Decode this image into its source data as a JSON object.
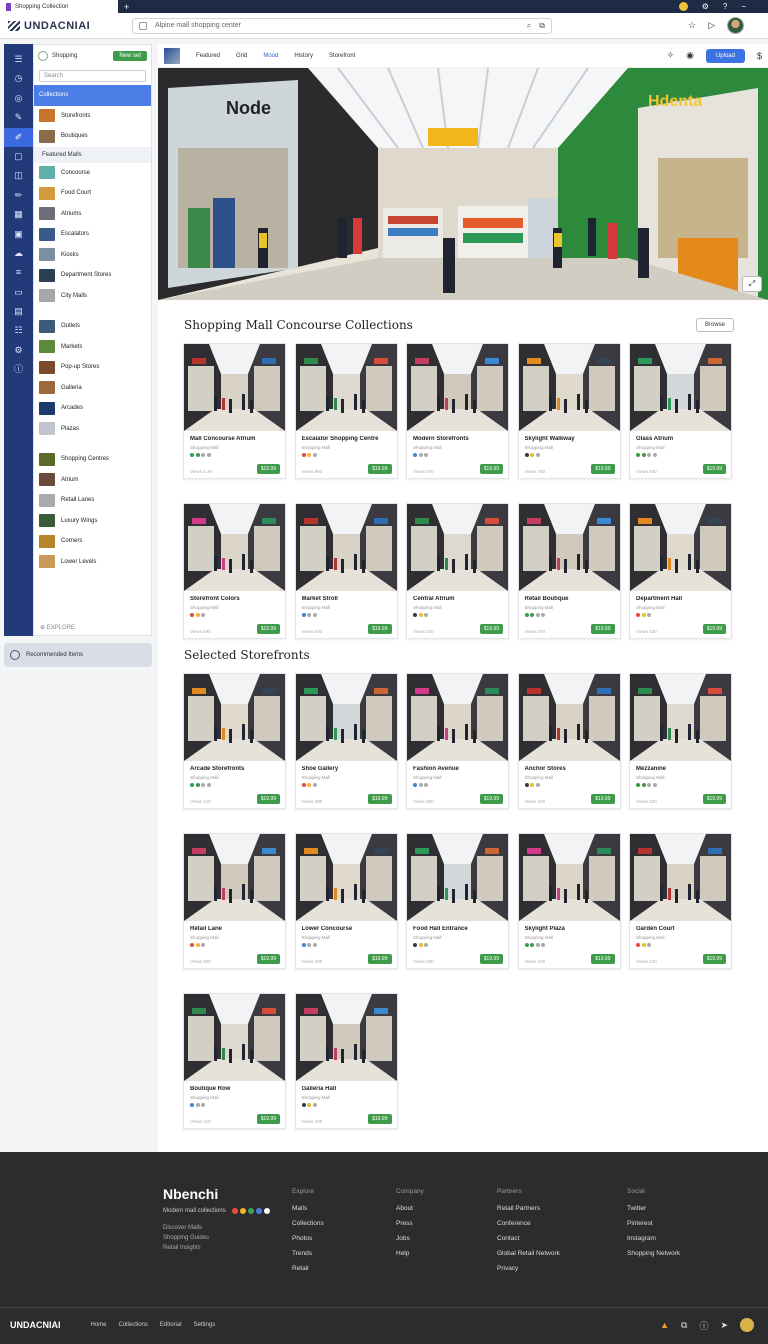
{
  "browser": {
    "tab_title": "Shopping Collection",
    "tab_plus": "+",
    "address_placeholder": "Alpine mall shopping center",
    "search_icon": "search-icon",
    "share_icon": "share-icon"
  },
  "app": {
    "logo": "UNDACNIAI"
  },
  "sidebar": {
    "title": "Shopping",
    "new_button": "New set",
    "search_placeholder": "Search",
    "items": [
      {
        "label": "Collections",
        "active": true,
        "color": "#4d7de6"
      },
      {
        "label": "Storefronts",
        "color": "#c8742a"
      },
      {
        "label": "Boutiques",
        "color": "#8a6b4a"
      },
      {
        "label": "Featured Malls",
        "group": true
      },
      {
        "label": "Concourse",
        "color": "#5fb0a8"
      },
      {
        "label": "Food Court",
        "color": "#d29a3a"
      },
      {
        "label": "Atriums",
        "color": "#6c6f7a"
      },
      {
        "label": "Escalators",
        "color": "#3a5a8a"
      },
      {
        "label": "Kiosks",
        "color": "#7d8fa2"
      },
      {
        "label": "Department Stores",
        "color": "#2d3d52"
      },
      {
        "label": "City Malls",
        "color": "#a7a7a7"
      },
      {
        "label": "",
        "gap": true
      },
      {
        "label": "Outlets",
        "color": "#3b5b7a"
      },
      {
        "label": "Markets",
        "color": "#5a8a3a"
      },
      {
        "label": "Pop-up Stores",
        "color": "#7a4a2a"
      },
      {
        "label": "Galleria",
        "color": "#9a6a3a"
      },
      {
        "label": "Arcades",
        "color": "#1c3a6a"
      },
      {
        "label": "Plazas",
        "color": "#c0c4cc"
      },
      {
        "label": "",
        "gap": true
      },
      {
        "label": "Shopping Centres",
        "color": "#5a6a2a"
      },
      {
        "label": "Atrium",
        "color": "#6a4a3a"
      },
      {
        "label": "Retail Lanes",
        "color": "#aaa"
      },
      {
        "label": "Luxury Wings",
        "color": "#3a5a3a"
      },
      {
        "label": "Corners",
        "color": "#b9852a"
      },
      {
        "label": "Lower Levels",
        "color": "#c79a5a"
      }
    ],
    "footer": "EXPLORE",
    "extra_label": "Recommended Items"
  },
  "rail_icons": [
    "menu-icon",
    "home-icon",
    "compass-icon",
    "pin-icon",
    "brush-icon",
    "square-icon",
    "layers-icon",
    "pencil-icon",
    "grid-icon",
    "image-icon",
    "cloud-icon",
    "sliders-icon",
    "card-icon",
    "table-icon",
    "list-icon",
    "settings-icon",
    "info-icon"
  ],
  "subnav": {
    "items": [
      "Featured",
      "Grid",
      "Mood",
      "History",
      "Storefront"
    ],
    "selected": 2,
    "action": "Upload"
  },
  "sections": [
    {
      "title": "Shopping Mall Concourse Collections",
      "button": "Browse"
    },
    {
      "title": "Selected Storefronts"
    }
  ],
  "cards_a": [
    {
      "title": "Mall Concourse Atrium",
      "meta": "Shopping Mall",
      "stat": "Views 1.2K",
      "price": "$19.99"
    },
    {
      "title": "Escalator Shopping Centre",
      "meta": "Shopping Mall",
      "stat": "Views 980",
      "price": "$19.99"
    },
    {
      "title": "Modern Storefronts",
      "meta": "Shopping Mall",
      "stat": "Views 870",
      "price": "$19.99"
    },
    {
      "title": "Skylight Walkway",
      "meta": "Shopping Mall",
      "stat": "Views 760",
      "price": "$19.99"
    },
    {
      "title": "Glass Atrium",
      "meta": "Shopping Mall",
      "stat": "Views 640",
      "price": "$19.99"
    },
    {
      "title": "Storefront Colors",
      "meta": "Shopping Mall",
      "stat": "Views 590",
      "price": "$19.99"
    },
    {
      "title": "Market Stroll",
      "meta": "Shopping Mall",
      "stat": "Views 540",
      "price": "$19.99"
    },
    {
      "title": "Central Atrium",
      "meta": "Shopping Mall",
      "stat": "Views 510",
      "price": "$19.99"
    },
    {
      "title": "Retail Boutique",
      "meta": "Shopping Mall",
      "stat": "Views 470",
      "price": "$19.99"
    },
    {
      "title": "Department Hall",
      "meta": "Shopping Mall",
      "stat": "Views 430",
      "price": "$19.99"
    }
  ],
  "cards_b": [
    {
      "title": "Arcade Storefronts",
      "meta": "Shopping Mall",
      "stat": "Views 410",
      "price": "$19.99"
    },
    {
      "title": "Shoe Gallery",
      "meta": "Shopping Mall",
      "stat": "Views 390",
      "price": "$19.99"
    },
    {
      "title": "Fashion Avenue",
      "meta": "Shopping Mall",
      "stat": "Views 360",
      "price": "$19.99"
    },
    {
      "title": "Anchor Stores",
      "meta": "Shopping Mall",
      "stat": "Views 340",
      "price": "$19.99"
    },
    {
      "title": "Mezzanine",
      "meta": "Shopping Mall",
      "stat": "Views 320",
      "price": "$19.99"
    },
    {
      "title": "Retail Lane",
      "meta": "Shopping Mall",
      "stat": "Views 300",
      "price": "$19.99"
    },
    {
      "title": "Lower Concourse",
      "meta": "Shopping Mall",
      "stat": "Views 280",
      "price": "$19.99"
    },
    {
      "title": "Food Hall Entrance",
      "meta": "Shopping Mall",
      "stat": "Views 260",
      "price": "$19.99"
    },
    {
      "title": "Skylight Plaza",
      "meta": "Shopping Mall",
      "stat": "Views 240",
      "price": "$19.99"
    },
    {
      "title": "Garden Court",
      "meta": "Shopping Mall",
      "stat": "Views 220",
      "price": "$19.99"
    },
    {
      "title": "Boutique Row",
      "meta": "Shopping Mall",
      "stat": "Views 210",
      "price": "$19.99"
    },
    {
      "title": "Galleria Hall",
      "meta": "Shopping Mall",
      "stat": "Views 200",
      "price": "$19.99"
    }
  ],
  "footer": {
    "brand": "Nbenchi",
    "tagline": "Modern mall collections",
    "small_lines": [
      "Discover Malls",
      "Shopping Guides",
      "Retail Insights"
    ],
    "columns": [
      {
        "head": "Explore",
        "items": [
          "Malls",
          "Collections",
          "Photos",
          "Trends",
          "Retail"
        ]
      },
      {
        "head": "Company",
        "items": [
          "About",
          "Press",
          "Jobs",
          "Help"
        ]
      },
      {
        "head": "Partners",
        "items": [
          "Retail Partners",
          "Conference",
          "Contact",
          "Global Retail Network",
          "Privacy"
        ]
      },
      {
        "head": "Social",
        "items": [
          "Twitter",
          "Pinterest",
          "Instagram",
          "Shopping Network"
        ]
      }
    ],
    "bottom_brand": "UNDACNIAI",
    "bottom_links": [
      "Home",
      "Collections",
      "Editorial",
      "Settings"
    ],
    "dot_colors": [
      "#e94b3c",
      "#f3b728",
      "#3ea55a",
      "#4a7fe0",
      "#ffffff"
    ]
  },
  "colors": {
    "accent": "#3b74e0",
    "sidebar_rail": "#233a7a",
    "price_green": "#3e9b4a",
    "footer_bg": "#2c2c2e"
  }
}
